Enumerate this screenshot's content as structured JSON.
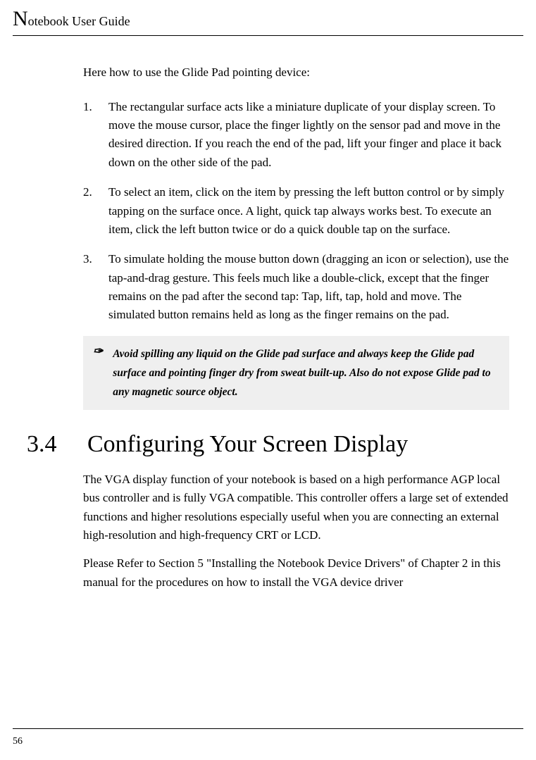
{
  "header": {
    "title_rest": "otebook User Guide",
    "drop_cap": "N"
  },
  "intro": "Here how to use the Glide Pad pointing device:",
  "list": [
    "The rectangular surface acts like a miniature duplicate of your display screen. To move the mouse cursor, place the finger lightly on the sensor pad and move in the desired direction. If you reach the end of the pad, lift your finger and place it back down on the other side of the pad.",
    "To select an item, click on the item by pressing the left button control or by simply tapping on the surface once. A light, quick tap always works best. To execute an item, click the left button twice or do a quick double tap on the surface.",
    "To simulate holding the mouse button down (dragging an icon or selection), use the tap-and-drag gesture. This feels much like a double-click, except that the finger remains on the pad after the second tap: Tap, lift, tap, hold and move. The simulated button remains held as long as the finger remains on the pad."
  ],
  "note": {
    "icon": "✑",
    "text": "Avoid spilling any liquid on the Glide pad surface and always keep the Glide pad surface and pointing finger dry from sweat built-up. Also do not expose Glide pad to any magnetic source object."
  },
  "section": {
    "number": "3.4",
    "title": "Configuring Your Screen Display"
  },
  "paragraphs": [
    "The VGA display function of your notebook is based on a high performance AGP local bus controller and is fully VGA compatible. This controller offers a large set of extended functions and higher resolutions especially useful when you are connecting an external high-resolution and high-frequency CRT or LCD.",
    "Please Refer to Section 5 \"Installing the Notebook Device Drivers\" of Chapter 2 in this manual for the procedures on how to install the VGA device driver"
  ],
  "page_number": "56"
}
